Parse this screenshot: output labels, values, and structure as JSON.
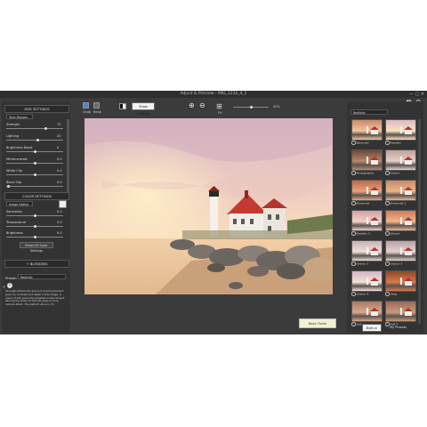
{
  "window": {
    "title": "Adjust & Preview - IMG_1232_4_1",
    "controls": "—  ▢  ✕"
  },
  "hdr_settings": {
    "header": "HDR SETTINGS",
    "dropdown": "Tone Mapper",
    "sliders": [
      {
        "label": "Strength",
        "value": "70",
        "level": 0.7
      },
      {
        "label": "Lighting",
        "value": "20",
        "level": 0.55
      },
      {
        "label": "Brightness Boost",
        "value": "0",
        "level": 0.5
      },
      {
        "label": "Microcontrast",
        "value": "0.0",
        "level": 0.5
      },
      {
        "label": "White Clip",
        "value": "0.0",
        "level": 0.5
      },
      {
        "label": "Black Clip",
        "value": "0.0",
        "level": 0.02
      }
    ]
  },
  "color_settings": {
    "header": "COLOR SETTINGS",
    "dropdown": "Image Native",
    "sliders": [
      {
        "label": "Saturation",
        "value": "0.0",
        "level": 0.5
      },
      {
        "label": "Temperature",
        "value": "0.0",
        "level": 0.5
      },
      {
        "label": "Brightness",
        "value": "0.0",
        "level": 0.5
      }
    ],
    "reset_button": "Reset All Color Settings"
  },
  "blending": {
    "header": "+ BLENDING",
    "preset_label": "Preset:",
    "preset_value": "Realistic",
    "help_text": "Strength affects the amount of enhancement given to contrast and detail in the image. A value of 100 gives the greatest enhancement. Moving the slider to the left gives a more natural effect. The default value is 70."
  },
  "toolbar": {
    "undo": "Undo",
    "redo": "Redo",
    "show_original": "Show Original",
    "fit": "Fit",
    "zoom_value": "50%",
    "zoom_level": 0.5
  },
  "next_button": "Next: Finish",
  "presets_panel": {
    "dropdown": "Realistic",
    "items": [
      {
        "label": "Balanced"
      },
      {
        "label": "Realistic"
      },
      {
        "label": "Photographic"
      },
      {
        "label": "Interior"
      },
      {
        "label": "Enhanced"
      },
      {
        "label": "Enhanced 2"
      },
      {
        "label": "Realistic 2"
      },
      {
        "label": "Vibrant"
      },
      {
        "label": "Interior 2"
      },
      {
        "label": "Interior 3"
      },
      {
        "label": "Interior 4"
      },
      {
        "label": "Deep"
      },
      {
        "label": "Soft"
      },
      {
        "label": "Soft 2"
      }
    ],
    "tab_builtin": "Built-in",
    "tab_my": "My Presets"
  }
}
